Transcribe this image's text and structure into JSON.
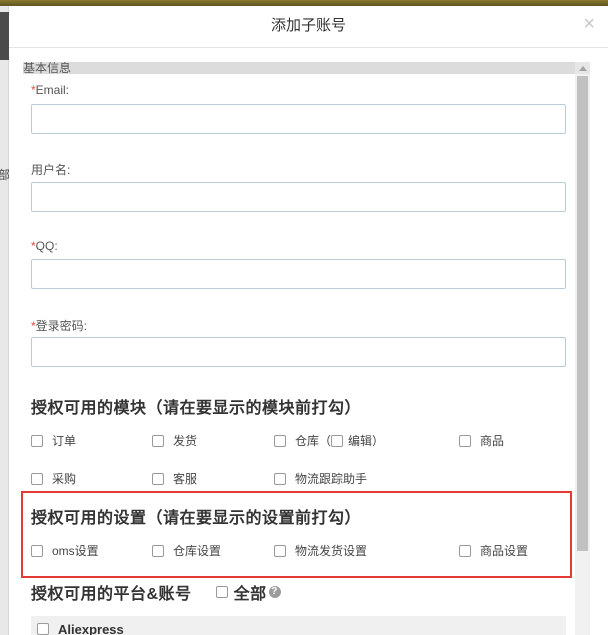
{
  "modal": {
    "title": "添加子账号",
    "close_symbol": "×"
  },
  "section_basic": "基本信息",
  "fields": {
    "email": {
      "required_mark": "*",
      "label": "Email:",
      "value": ""
    },
    "username": {
      "label": "用户名:",
      "value": ""
    },
    "qq": {
      "required_mark": "*",
      "label": "QQ:",
      "value": ""
    },
    "password": {
      "required_mark": "*",
      "label": "登录密码:",
      "value": ""
    }
  },
  "modules": {
    "title": "授权可用的模块（请在要显示的模块前打勾）",
    "items": [
      "订单",
      "发货",
      "仓库",
      "商品",
      "采购",
      "客服",
      "物流跟踪助手"
    ],
    "warehouse_edit": {
      "open": "（",
      "label": "编辑",
      "close": "）"
    }
  },
  "settings": {
    "title": "授权可用的设置（请在要显示的设置前打勾）",
    "items": [
      "oms设置",
      "仓库设置",
      "物流发货设置",
      "商品设置"
    ]
  },
  "platforms": {
    "title": "授权可用的平台&账号",
    "all_label": "全部",
    "help_icon": "?",
    "rows": [
      "Aliexpress"
    ]
  },
  "left_edge_glyph": "部",
  "colors": {
    "highlight_border": "#e53935",
    "required": "#ee4444",
    "input_border": "#b9cad9"
  },
  "icons": {
    "close": "close-icon",
    "help": "help-circle-icon",
    "scroll_up": "scroll-up-arrow-icon"
  }
}
